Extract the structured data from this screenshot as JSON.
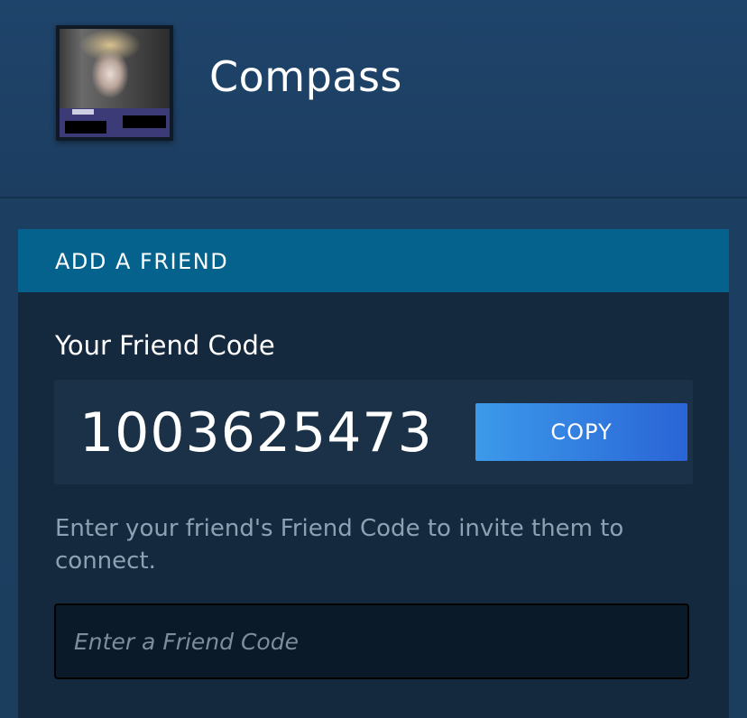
{
  "header": {
    "app_title": "Compass",
    "avatar": "user-avatar-photo"
  },
  "add_friend": {
    "section_title": "ADD A FRIEND",
    "your_code_label": "Your Friend Code",
    "friend_code": "1003625473",
    "copy_label": "COPY",
    "instructions": "Enter your friend's Friend Code to invite them to connect.",
    "input": {
      "placeholder": "Enter a Friend Code",
      "value": ""
    }
  },
  "colors": {
    "background": "#1d3f62",
    "panel": "#14293e",
    "panel_header": "#05628c",
    "copy_button_start": "#3c9aea",
    "copy_button_end": "#2a64d6"
  }
}
